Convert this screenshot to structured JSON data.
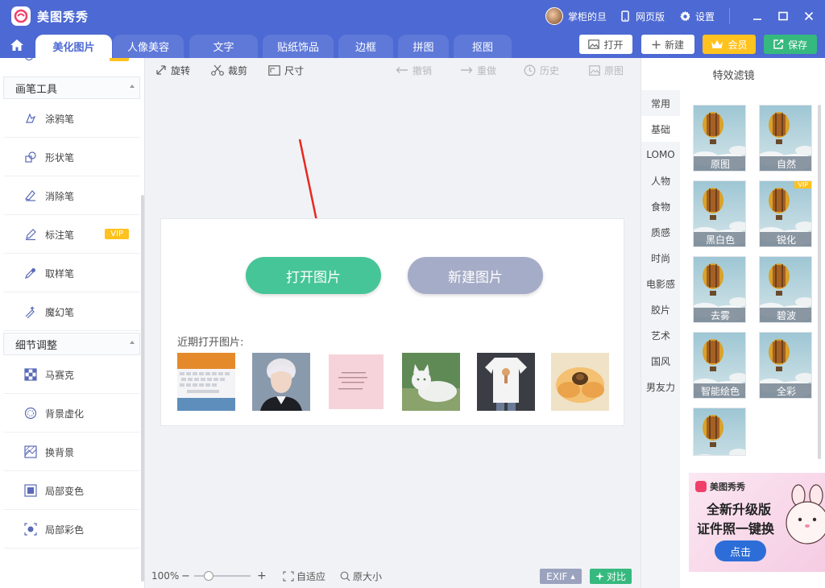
{
  "app": {
    "title": "美图秀秀"
  },
  "titlebar": {
    "user_name": "掌柜的旦",
    "web_version": "网页版",
    "settings": "设置"
  },
  "tabs": [
    {
      "label": "美化图片",
      "active": true
    },
    {
      "label": "人像美容",
      "active": false
    },
    {
      "label": "文字",
      "active": false
    },
    {
      "label": "贴纸饰品",
      "active": false
    },
    {
      "label": "边框",
      "active": false
    },
    {
      "label": "拼图",
      "active": false
    },
    {
      "label": "抠图",
      "active": false
    }
  ],
  "header_buttons": {
    "open": "打开",
    "new": "新建",
    "vip": "会员",
    "save": "保存"
  },
  "sidebar": {
    "sections": [
      {
        "title": "画笔工具",
        "items": [
          {
            "label": "涂鸦笔",
            "icon": "doodle-pen-icon",
            "vip": false
          },
          {
            "label": "形状笔",
            "icon": "shape-pen-icon",
            "vip": false
          },
          {
            "label": "消除笔",
            "icon": "eraser-pen-icon",
            "vip": false
          },
          {
            "label": "标注笔",
            "icon": "marker-pen-icon",
            "vip": true
          },
          {
            "label": "取样笔",
            "icon": "sample-pen-icon",
            "vip": false
          },
          {
            "label": "魔幻笔",
            "icon": "magic-pen-icon",
            "vip": false
          }
        ]
      },
      {
        "title": "细节调整",
        "items": [
          {
            "label": "马赛克",
            "icon": "mosaic-icon",
            "vip": false
          },
          {
            "label": "背景虚化",
            "icon": "blur-background-icon",
            "vip": false
          },
          {
            "label": "换背景",
            "icon": "change-background-icon",
            "vip": false
          },
          {
            "label": "局部变色",
            "icon": "local-color-change-icon",
            "vip": false
          },
          {
            "label": "局部彩色",
            "icon": "local-color-icon",
            "vip": false
          }
        ]
      }
    ],
    "vip_label": "VIP"
  },
  "toolbar": {
    "rotate": "旋转",
    "crop": "裁剪",
    "size": "尺寸",
    "undo": "撤销",
    "redo": "重做",
    "history": "历史",
    "original": "原图"
  },
  "canvas": {
    "open_image": "打开图片",
    "new_image": "新建图片",
    "recent_label": "近期打开图片:"
  },
  "status": {
    "zoom": "100%",
    "fit": "自适应",
    "actual_size": "原大小",
    "exif": "EXIF",
    "compare": "对比"
  },
  "filters": {
    "title": "特效滤镜",
    "categories": [
      {
        "label": "常用",
        "active": false
      },
      {
        "label": "基础",
        "active": true
      },
      {
        "label": "LOMO",
        "active": false
      },
      {
        "label": "人物",
        "active": false
      },
      {
        "label": "食物",
        "active": false
      },
      {
        "label": "质感",
        "active": false
      },
      {
        "label": "时尚",
        "active": false
      },
      {
        "label": "电影感",
        "active": false
      },
      {
        "label": "胶片",
        "active": false
      },
      {
        "label": "艺术",
        "active": false
      },
      {
        "label": "国风",
        "active": false
      },
      {
        "label": "男友力",
        "active": false
      }
    ],
    "items": [
      {
        "label": "原图",
        "vip": false
      },
      {
        "label": "自然",
        "vip": false
      },
      {
        "label": "黑白色",
        "vip": false
      },
      {
        "label": "锐化",
        "vip": true
      },
      {
        "label": "去雾",
        "vip": false
      },
      {
        "label": "碧波",
        "vip": false
      },
      {
        "label": "智能绘色",
        "vip": false
      },
      {
        "label": "全彩",
        "vip": false
      },
      {
        "label": "",
        "vip": false
      }
    ]
  },
  "ad": {
    "brand": "美图秀秀",
    "line1": "全新升级版",
    "line2": "证件照一键换",
    "cta": "点击"
  },
  "colors": {
    "primary": "#4d69d3",
    "open_green": "#46c598",
    "new_grey": "#a5acc7",
    "vip_gold": "#ffc21e",
    "save_green": "#36b97e"
  }
}
